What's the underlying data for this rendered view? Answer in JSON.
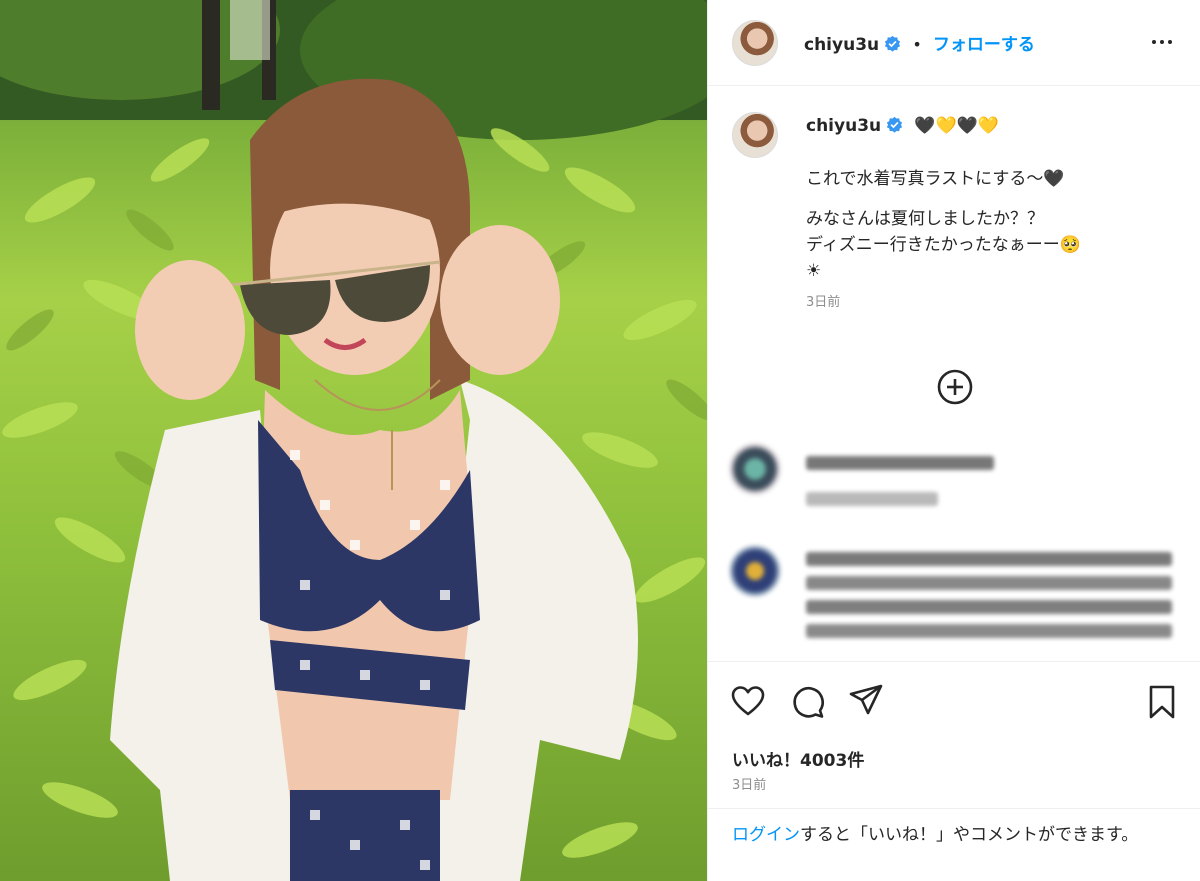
{
  "post": {
    "username": "chiyu3u",
    "follow_label": "フォローする",
    "separator": "•",
    "caption": {
      "emojis": "🖤💛🖤💛",
      "line1": "これで水着写真ラストにする〜🖤",
      "line2": "みなさんは夏何しましたか？？",
      "line3": "ディズニー行きたかったなぁーー🥺",
      "line4": "☀",
      "time": "3日前"
    },
    "likes": "いいね！4003件",
    "date": "3日前",
    "login_prompt": {
      "link": "ログイン",
      "text": "すると「いいね！」やコメントができます。"
    }
  },
  "icons": {
    "verified": "verified-badge-icon",
    "more": "more-options-icon",
    "load_more": "plus-circle-icon",
    "like": "heart-icon",
    "comment": "comment-icon",
    "share": "share-icon",
    "save": "bookmark-icon"
  },
  "colors": {
    "accent": "#0095f6",
    "verified": "#3897f0",
    "text": "#262626",
    "muted": "#8e8e8e"
  }
}
